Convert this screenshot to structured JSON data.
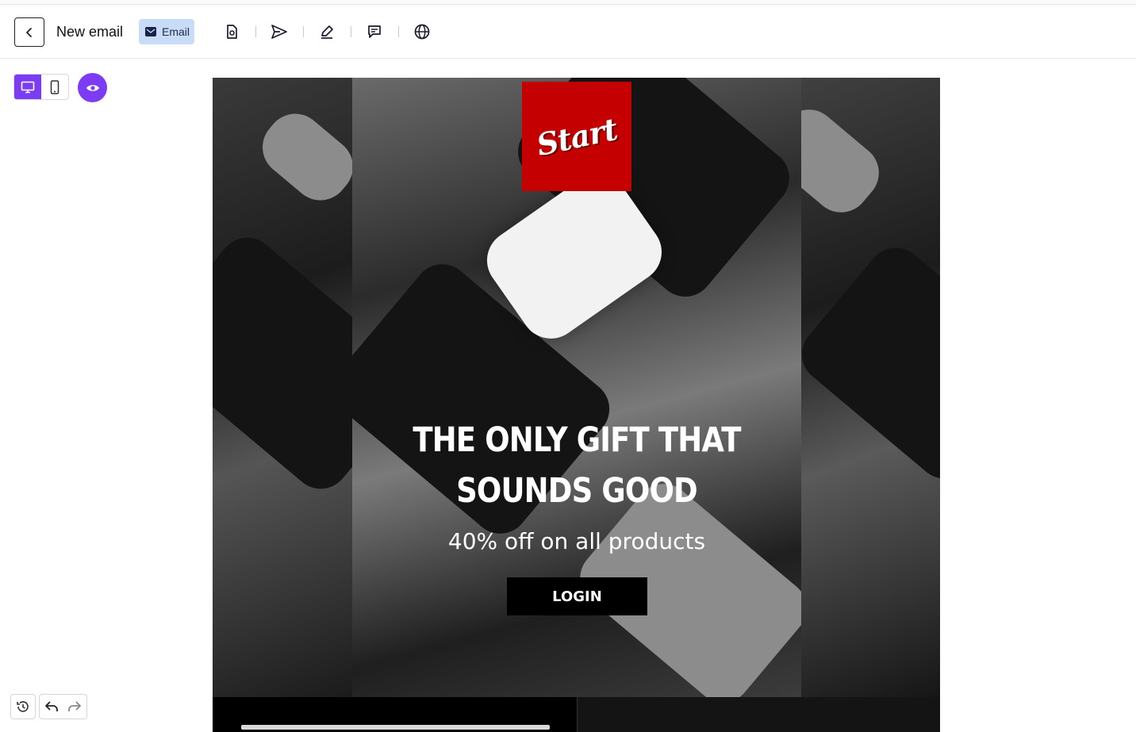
{
  "toolbar": {
    "back_icon": "chevron-left-icon",
    "title": "New email",
    "badge_label": "Email",
    "badge_icon": "envelope-icon",
    "tools": [
      "file-settings-icon",
      "send-icon",
      "pen-edit-icon",
      "comment-icon",
      "globe-icon"
    ]
  },
  "view_controls": {
    "desktop_icon": "desktop-icon",
    "mobile_icon": "mobile-icon",
    "preview_icon": "eye-icon",
    "active_view": "desktop"
  },
  "email": {
    "logo_text": "Start",
    "headline": "THE ONLY GIFT THAT SOUNDS GOOD",
    "subline": "40% off on all products",
    "button_label": "LOGIN",
    "colors": {
      "logo_bg": "#c40000",
      "button_bg": "#000000",
      "accent": "#7b3cf4"
    }
  },
  "history": {
    "history_icon": "history-icon",
    "undo_icon": "undo-icon",
    "redo_icon": "redo-icon"
  }
}
